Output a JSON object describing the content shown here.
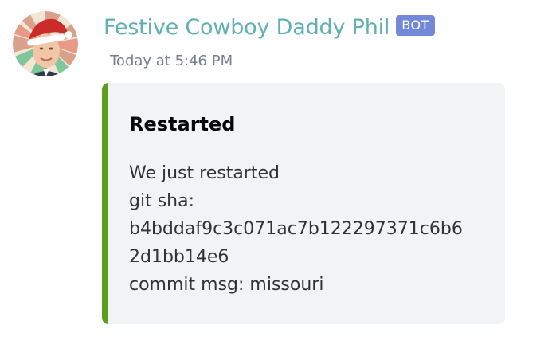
{
  "message": {
    "username": "Festive Cowboy Daddy Phil",
    "bot_tag": "BOT",
    "timestamp": "Today at 5:46 PM",
    "username_color": "#5fb0b0",
    "embed": {
      "accent_color": "#5a9e1e",
      "title": "Restarted",
      "description_lines": [
        "We just restarted",
        "git sha:",
        "b4bddaf9c3c071ac7b122297371c6b6",
        "2d1bb14e6",
        "commit msg: missouri"
      ]
    },
    "avatar": {
      "icon": "festive-avatar-icon"
    }
  }
}
